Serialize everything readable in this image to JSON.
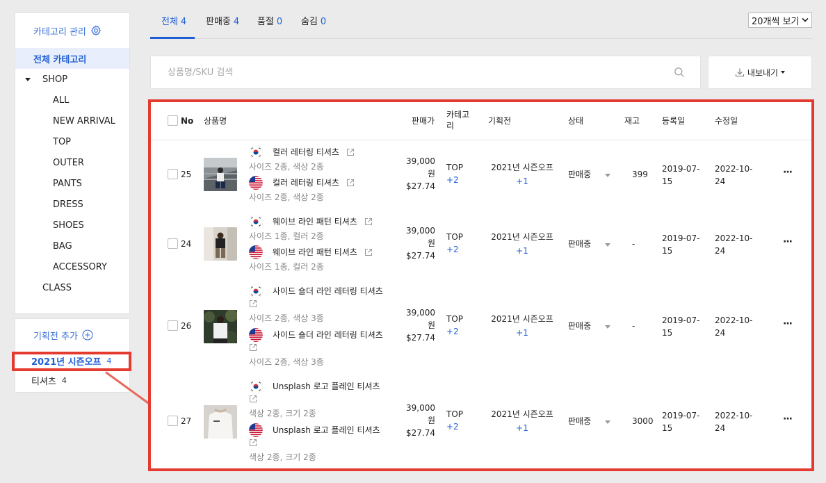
{
  "sidebar": {
    "category_manage_label": "카테고리 관리",
    "all_category_label": "전체 카테고리",
    "shop_label": "SHOP",
    "shop_children": [
      "ALL",
      "NEW ARRIVAL",
      "TOP",
      "OUTER",
      "PANTS",
      "DRESS",
      "SHOES",
      "BAG",
      "ACCESSORY"
    ],
    "class_label": "CLASS",
    "exhibition_add_label": "기획전 추가",
    "exhibitions": [
      {
        "name": "2021년 시즌오프",
        "count": "4"
      },
      {
        "name": "티셔츠",
        "count": "4"
      }
    ]
  },
  "tabs": [
    {
      "label": "전체",
      "count": "4"
    },
    {
      "label": "판매중",
      "count": "4"
    },
    {
      "label": "품절",
      "count": "0"
    },
    {
      "label": "숨김",
      "count": "0"
    }
  ],
  "per_page": "20개씩 보기",
  "search": {
    "placeholder": "상품명/SKU 검색"
  },
  "export_label": "내보내기",
  "table": {
    "headers": {
      "no": "No",
      "name": "상품명",
      "price": "판매가",
      "category_1": "카테고",
      "category_2": "리",
      "exhibition": "기획전",
      "status": "상태",
      "stock": "재고",
      "registered": "등록일",
      "modified": "수정일"
    },
    "rows": [
      {
        "no": "25",
        "name_kr": "컬러 레터링 티셔츠",
        "desc_kr": "사이즈 2종, 색상 2종",
        "name_en": "컬러 레터링 티셔츠",
        "desc_en": "사이즈 2종, 색상 2종",
        "price_krw": "39,000",
        "price_unit": "원",
        "price_usd": "$27.74",
        "category": "TOP",
        "category_more": "+2",
        "exhibition": "2021년 시즌오프",
        "exhibition_more": "+1",
        "status": "판매중",
        "stock": "399",
        "registered_1": "2019-07-",
        "registered_2": "15",
        "modified_1": "2022-10-",
        "modified_2": "24"
      },
      {
        "no": "24",
        "name_kr": "웨이브 라인 패턴 티셔츠",
        "desc_kr": "사이즈 1종, 컬러 2종",
        "name_en": "웨이브 라인 패턴 티셔츠",
        "desc_en": "사이즈 1종, 컬러 2종",
        "price_krw": "39,000",
        "price_unit": "원",
        "price_usd": "$27.74",
        "category": "TOP",
        "category_more": "+2",
        "exhibition": "2021년 시즌오프",
        "exhibition_more": "+1",
        "status": "판매중",
        "stock": "-",
        "registered_1": "2019-07-",
        "registered_2": "15",
        "modified_1": "2022-10-",
        "modified_2": "24"
      },
      {
        "no": "26",
        "name_kr": "사이드 숄더 라인 레터링 티셔츠",
        "desc_kr": "사이즈 2종, 색상 3종",
        "name_en": "사이드 숄더 라인 레터링 티셔츠",
        "desc_en": "사이즈 2종, 색상 3종",
        "price_krw": "39,000",
        "price_unit": "원",
        "price_usd": "$27.74",
        "category": "TOP",
        "category_more": "+2",
        "exhibition": "2021년 시즌오프",
        "exhibition_more": "+1",
        "status": "판매중",
        "stock": "-",
        "registered_1": "2019-07-",
        "registered_2": "15",
        "modified_1": "2022-10-",
        "modified_2": "24"
      },
      {
        "no": "27",
        "name_kr": "Unsplash 로고 플레인 티셔츠",
        "desc_kr": "색상 2종, 크기 2종",
        "name_en": "Unsplash 로고 플레인 티셔츠",
        "desc_en": "색상 2종, 크기 2종",
        "price_krw": "39,000",
        "price_unit": "원",
        "price_usd": "$27.74",
        "category": "TOP",
        "category_more": "+2",
        "exhibition": "2021년 시즌오프",
        "exhibition_more": "+1",
        "status": "판매중",
        "stock": "3000",
        "registered_1": "2019-07-",
        "registered_2": "15",
        "modified_1": "2022-10-",
        "modified_2": "24"
      }
    ]
  },
  "colors": {
    "accent": "#1f5fd6",
    "highlight_box": "#e53a30"
  }
}
